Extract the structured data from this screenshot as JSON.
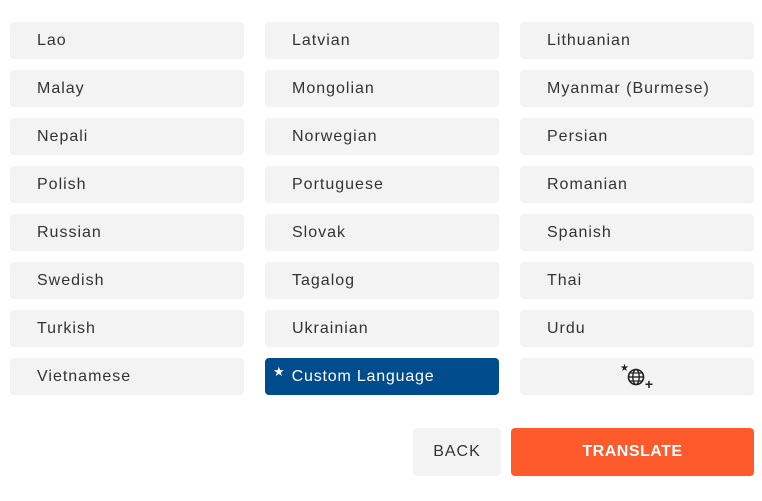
{
  "languages": [
    "Lao",
    "Latvian",
    "Lithuanian",
    "Malay",
    "Mongolian",
    "Myanmar (Burmese)",
    "Nepali",
    "Norwegian",
    "Persian",
    "Polish",
    "Portuguese",
    "Romanian",
    "Russian",
    "Slovak",
    "Spanish",
    "Swedish",
    "Tagalog",
    "Thai",
    "Turkish",
    "Ukrainian",
    "Urdu",
    "Vietnamese"
  ],
  "custom_language": {
    "label": "Custom Language",
    "star": "★",
    "selected": true
  },
  "add_language_icon": "globe-star-plus-icon",
  "actions": {
    "back_label": "BACK",
    "translate_label": "TRANSLATE"
  },
  "colors": {
    "tile_bg": "#f3f3f3",
    "selected_bg": "#004c8d",
    "accent": "#fe5a2b"
  }
}
